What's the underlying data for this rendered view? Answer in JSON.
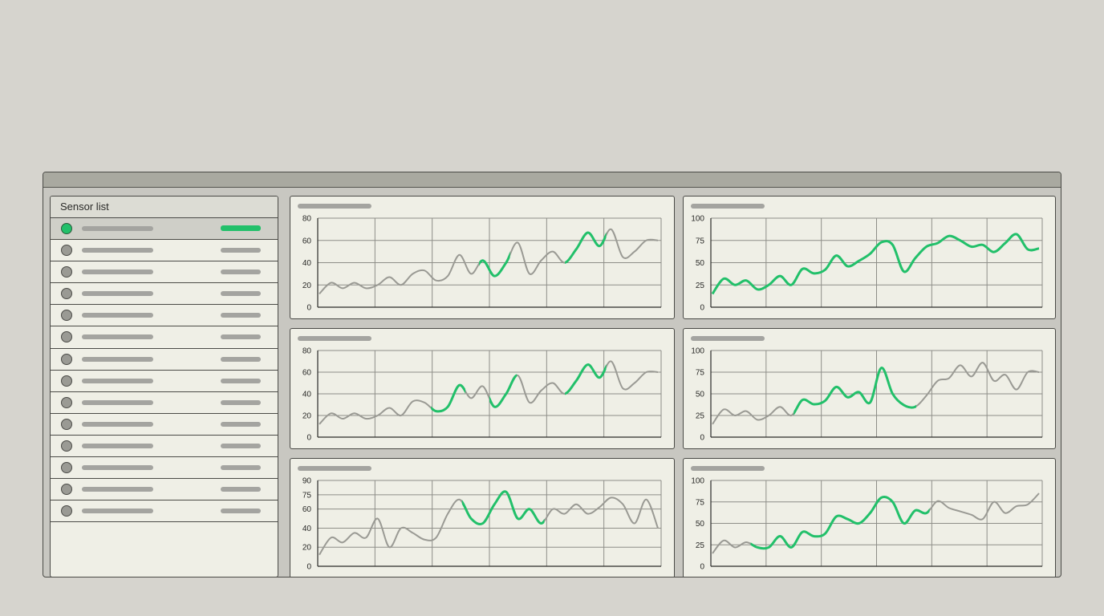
{
  "sidebar": {
    "title": "Sensor list",
    "selected_index": 0,
    "sensor_count": 14
  },
  "colors": {
    "highlight": "#22c06a",
    "baseline": "#9a9a94",
    "grid": "#8e8e88",
    "panel_bg": "#efefe6",
    "window_bg": "#c8c7c1"
  },
  "chart_data": [
    {
      "type": "line",
      "ylim": [
        0,
        80
      ],
      "yticks": [
        "0",
        "20",
        "40",
        "60",
        "80"
      ],
      "highlight_range": [
        [
          0.47,
          0.56
        ],
        [
          0.72,
          0.84
        ]
      ],
      "series": [
        {
          "values": [
            12,
            22,
            17,
            22,
            17,
            20,
            27,
            20,
            30,
            33,
            24,
            28,
            47,
            30,
            42,
            28,
            40,
            58,
            30,
            42,
            50,
            40,
            52,
            67,
            55,
            70,
            45,
            50,
            60,
            60
          ]
        }
      ]
    },
    {
      "type": "line",
      "ylim": [
        0,
        100
      ],
      "yticks": [
        "0",
        "25",
        "50",
        "75",
        "100"
      ],
      "highlight_range": [
        [
          0.0,
          1.0
        ]
      ],
      "series": [
        {
          "values": [
            15,
            32,
            25,
            30,
            20,
            25,
            35,
            25,
            43,
            38,
            42,
            58,
            46,
            52,
            60,
            73,
            70,
            40,
            55,
            68,
            72,
            80,
            75,
            68,
            70,
            62,
            72,
            82,
            65,
            66
          ]
        }
      ]
    },
    {
      "type": "line",
      "ylim": [
        0,
        80
      ],
      "yticks": [
        "0",
        "20",
        "40",
        "60",
        "80"
      ],
      "highlight_range": [
        [
          0.33,
          0.43
        ],
        [
          0.5,
          0.58
        ],
        [
          0.72,
          0.84
        ]
      ],
      "series": [
        {
          "values": [
            12,
            22,
            17,
            22,
            17,
            20,
            27,
            20,
            33,
            32,
            24,
            28,
            48,
            36,
            47,
            28,
            40,
            57,
            32,
            43,
            50,
            40,
            52,
            67,
            55,
            70,
            45,
            50,
            60,
            60
          ]
        }
      ]
    },
    {
      "type": "line",
      "ylim": [
        0,
        100
      ],
      "yticks": [
        "0",
        "25",
        "50",
        "75",
        "100"
      ],
      "highlight_range": [
        [
          0.25,
          0.62
        ]
      ],
      "series": [
        {
          "values": [
            15,
            32,
            25,
            30,
            20,
            25,
            35,
            25,
            43,
            38,
            42,
            58,
            46,
            52,
            40,
            80,
            50,
            37,
            35,
            48,
            65,
            68,
            83,
            70,
            86,
            65,
            72,
            55,
            75,
            75
          ]
        }
      ]
    },
    {
      "type": "line",
      "ylim": [
        0,
        90
      ],
      "yticks": [
        "0",
        "20",
        "40",
        "60",
        "75",
        "90"
      ],
      "highlight_range": [
        [
          0.42,
          0.66
        ]
      ],
      "series": [
        {
          "values": [
            12,
            30,
            25,
            35,
            30,
            50,
            20,
            40,
            35,
            28,
            30,
            55,
            70,
            50,
            45,
            65,
            78,
            50,
            60,
            45,
            60,
            55,
            65,
            55,
            62,
            72,
            65,
            45,
            70,
            40
          ]
        }
      ]
    },
    {
      "type": "line",
      "ylim": [
        0,
        100
      ],
      "yticks": [
        "0",
        "25",
        "50",
        "75",
        "100"
      ],
      "highlight_range": [
        [
          0.12,
          0.66
        ]
      ],
      "series": [
        {
          "values": [
            15,
            30,
            22,
            28,
            22,
            22,
            35,
            22,
            40,
            35,
            38,
            58,
            55,
            50,
            62,
            80,
            75,
            50,
            65,
            62,
            76,
            68,
            64,
            60,
            55,
            75,
            62,
            70,
            72,
            85
          ]
        }
      ]
    }
  ]
}
